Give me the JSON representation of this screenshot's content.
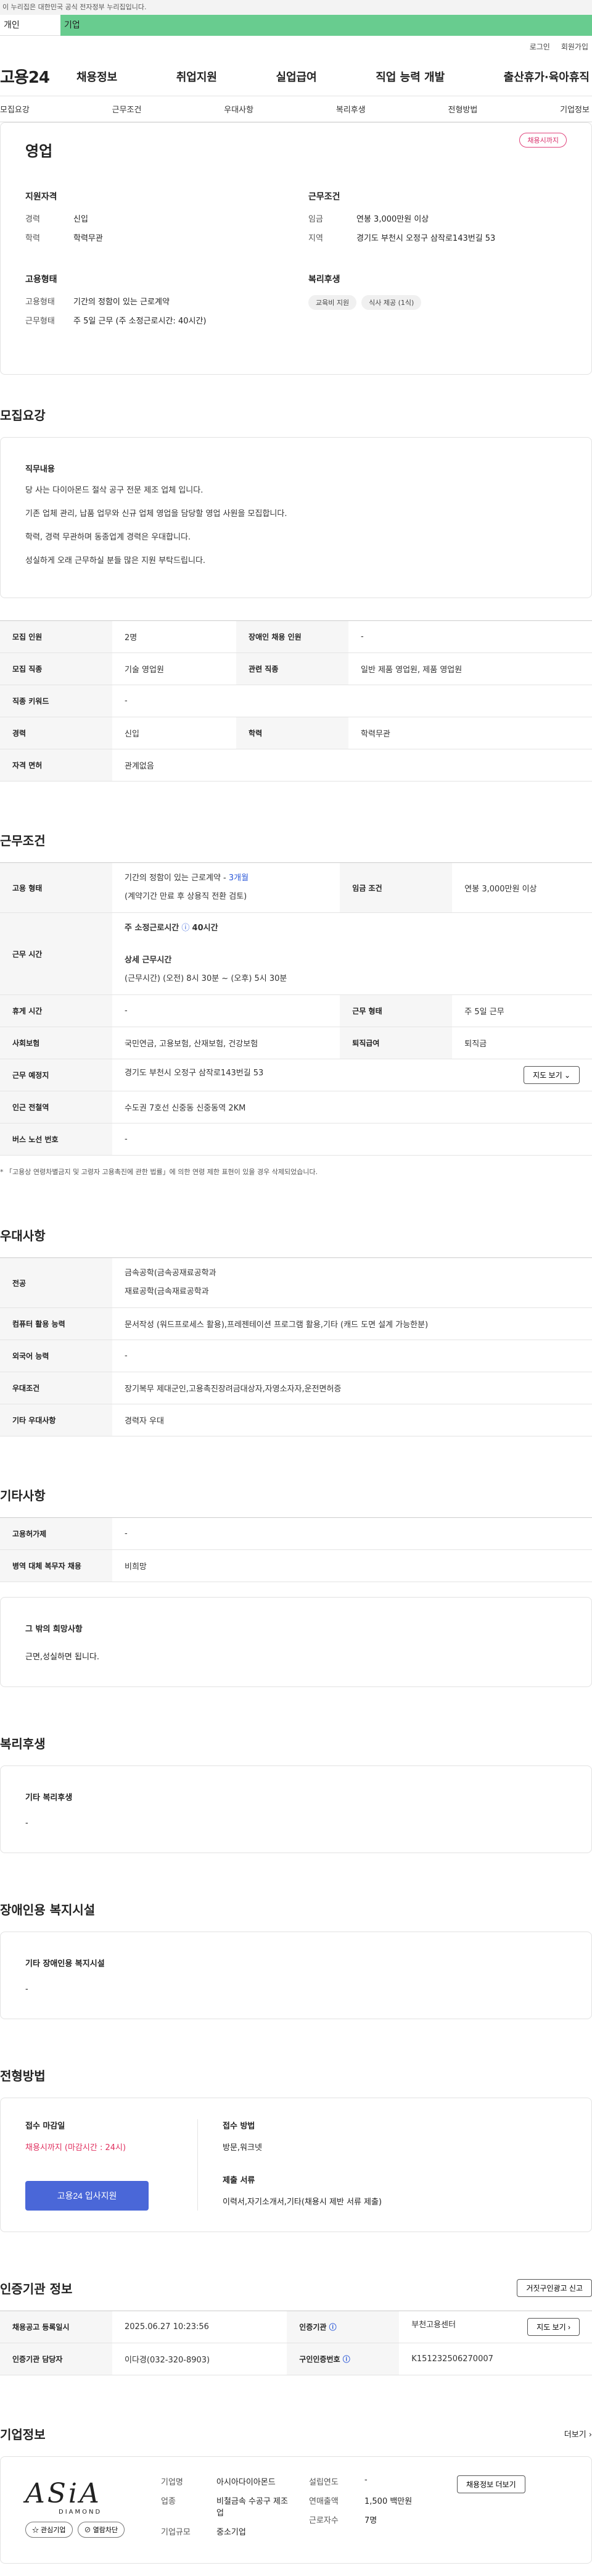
{
  "govbar": "이 누리집은 대한민국 공식 전자정부 누리집입니다.",
  "topbar": {
    "personal": "개인",
    "company": "기업"
  },
  "util": {
    "login": "로그인",
    "join": "회원가입"
  },
  "gnb": {
    "logo": "고용24",
    "items": [
      "채용정보",
      "취업지원",
      "실업급여",
      "직업 능력 개발",
      "출산휴가·육아휴직"
    ]
  },
  "subnav": [
    "모집요강",
    "근무조건",
    "우대사항",
    "복리후생",
    "전형방법",
    "기업정보"
  ],
  "summary": {
    "title": "영업",
    "badge": "채용시까지",
    "qual_h": "지원자격",
    "career_k": "경력",
    "career_v": "신입",
    "edu_k": "학력",
    "edu_v": "학력무관",
    "cond_h": "근무조건",
    "wage_k": "임금",
    "wage_v": "연봉 3,000만원 이상",
    "region_k": "지역",
    "region_v": "경기도 부천시 오정구 삼작로143번길 53",
    "emp_h": "고용형태",
    "emptype_k": "고용형태",
    "emptype_v": "기간의 정함이 있는 근로계약",
    "worktype_k": "근무형태",
    "worktype_v": "주 5일 근무 (주 소정근로시간: 40시간)",
    "welfare_h": "복리후생",
    "tags": [
      "교육비 지원",
      "식사 제공 (1식)"
    ]
  },
  "recruit": {
    "title": "모집요강",
    "duty_h": "직무내용",
    "lines": [
      "당 사는 다이아몬드 절삭 공구 전문 제조 업체 입니다.",
      "기존 업체 관리, 납품 업무와 신규 업체 영업을 담당할 영업 사원을 모집합니다.",
      "학력, 경력 무관하며 동종업계 경력은 우대합니다.",
      "성실하게 오래 근무하실 분들 많은 지원 부탁드립니다."
    ],
    "rows": {
      "headcount_k": "모집 인원",
      "headcount_v": "2명",
      "disabled_k": "장애인 채용 인원",
      "disabled_v": "-",
      "job_k": "모집 직종",
      "job_v": "기술 영업원",
      "related_k": "관련 직종",
      "related_v": "일반 제품 영업원, 제품 영업원",
      "keyword_k": "직종 키워드",
      "keyword_v": "-",
      "career_k": "경력",
      "career_v": "신입",
      "edu_k": "학력",
      "edu_v": "학력무관",
      "license_k": "자격 면허",
      "license_v": "관계없음"
    }
  },
  "work": {
    "title": "근무조건",
    "emptype_k": "고용 형태",
    "emptype_v": "기간의 정함이 있는 근로계약 - ",
    "emptype_months": "3개월",
    "emptype_note": "(계약기간 만료 후 상용직 전환 검토)",
    "wage_k": "임금 조건",
    "wage_v": "연봉 3,000만원 이상",
    "hours_k": "근무 시간",
    "hours_std": "주 소정근로시간",
    "hours_std_v": "40시간",
    "hours_detail_h": "상세 근무시간",
    "hours_detail_v": "(근무시간) (오전) 8시 30분 ~ (오후) 5시 30분",
    "rest_k": "휴게 시간",
    "rest_v": "-",
    "form_k": "근무 형태",
    "form_v": "주 5일 근무",
    "ins_k": "사회보험",
    "ins_v": "국민연금, 고용보험, 산재보험, 건강보험",
    "severance_k": "퇴직급여",
    "severance_v": "퇴직금",
    "place_k": "근무 예정지",
    "place_v": "경기도 부천시 오정구 삼작로143번길 53",
    "map_btn": "지도 보기 ⌄",
    "subway_k": "인근 전철역",
    "subway_v": "수도권 7호선 신중동 신중동역 2KM",
    "bus_k": "버스 노선 번호",
    "bus_v": "-",
    "note": "* 「고용상 연령차별금지 및 고령자 고용촉진에 관한 법률」에 의한 연령 제한 표현이 있을 경우 삭제되었습니다."
  },
  "pref": {
    "title": "우대사항",
    "major_k": "전공",
    "major_v1": "금속공학(금속공재료공학과",
    "major_v2": "재료공학(금속재료공학과",
    "computer_k": "컴퓨터 활용 능력",
    "computer_v": "문서작성 (워드프로세스 활용),프레젠테이션 프로그램 활용,기타 (캐드 도면 설계 가능한분)",
    "lang_k": "외국어 능력",
    "lang_v": "-",
    "cond_k": "우대조건",
    "cond_v": "장기복무 제대군인,고용촉진장려금대상자,자영소자자,운전면허증",
    "etc_k": "기타 우대사항",
    "etc_v": "경력자 우대"
  },
  "etc": {
    "title": "기타사항",
    "foreign_k": "고용허가제",
    "foreign_v": "-",
    "military_k": "병역 대체 복무자 채용",
    "military_v": "비희망",
    "wish_h": "그 밖의 희망사항",
    "wish_v": "근면,성실하면 됩니다."
  },
  "welfare": {
    "title": "복리후생",
    "h": "기타 복리후생",
    "v": "-"
  },
  "disabled": {
    "title": "장애인용 복지시설",
    "h": "기타 장애인용 복지시설",
    "v": "-"
  },
  "process": {
    "title": "전형방법",
    "deadline_h": "접수 마감일",
    "deadline_v": "채용시까지 (마감시간 : 24시)",
    "apply_btn": "고용24 입사지원",
    "method_h": "접수 방법",
    "method_v": "방문,워크넷",
    "docs_h": "제출 서류",
    "docs_v": "이력서,자기소개서,기타(채용시 제반 서류 제출)"
  },
  "certify": {
    "title": "인증기관 정보",
    "report_btn": "거짓구인광고 신고",
    "reg_k": "채용공고 등록일시",
    "reg_v": "2025.06.27 10:23:56",
    "org_k": "인증기관",
    "org_v": "부천고용센터",
    "map_btn": "지도 보기 ›",
    "manager_k": "인증기관 담당자",
    "manager_v": "이다경(032-320-8903)",
    "no_k": "구인인증번호",
    "no_v": "K151232506270007"
  },
  "corp": {
    "title": "기업정보",
    "more": "더보기 ›",
    "logo_text": "ASiA",
    "logo_sub": "DIAMOND",
    "fav_btn": "☆ 관심기업",
    "block_btn": "⊘ 열람차단",
    "name_k": "기업명",
    "name_v": "아시아다이아몬드",
    "biz_k": "업종",
    "biz_v": "비철금속 수공구 제조업",
    "size_k": "기업규모",
    "size_v": "중소기업",
    "founded_k": "설립연도",
    "founded_v": "-",
    "sales_k": "연매출액",
    "sales_v": "1,500 백만원",
    "staff_k": "근로자수",
    "staff_v": "7명",
    "jobs_btn": "채용정보 더보기"
  }
}
